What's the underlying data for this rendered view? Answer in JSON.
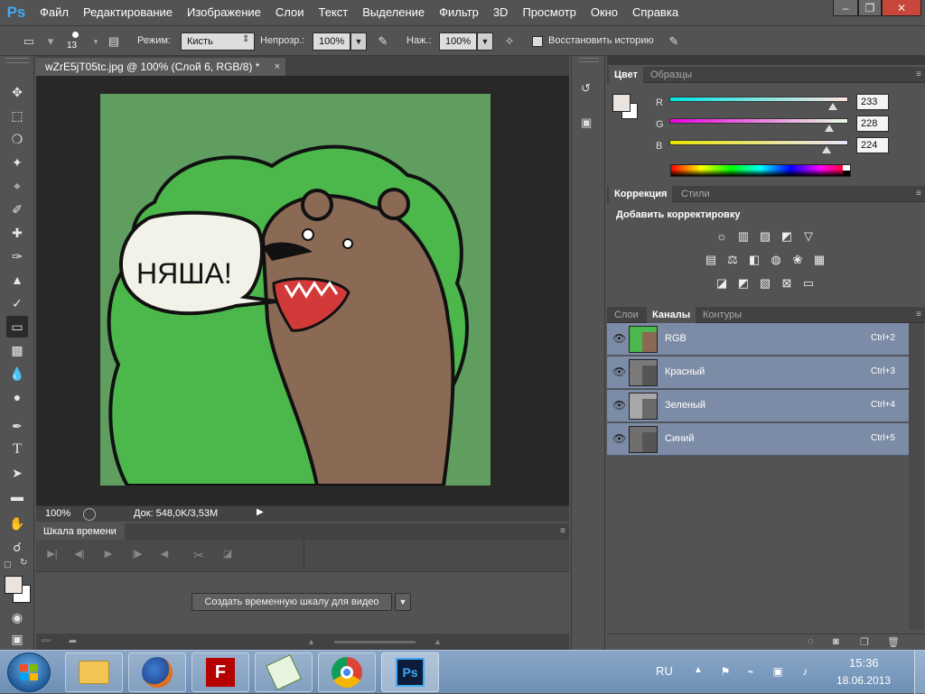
{
  "app": {
    "logo": "Ps",
    "menu": [
      "Файл",
      "Редактирование",
      "Изображение",
      "Слои",
      "Текст",
      "Выделение",
      "Фильтр",
      "3D",
      "Просмотр",
      "Окно",
      "Справка"
    ],
    "window_controls": {
      "minimize": "–",
      "restore": "❐",
      "close": "✕"
    }
  },
  "options_bar": {
    "brush_size": "13",
    "mode_label": "Режим:",
    "mode_value": "Кисть",
    "opacity_label": "Непрозр.:",
    "opacity_value": "100%",
    "flow_label": "Наж.:",
    "flow_value": "100%",
    "restore_history_label": "Восстановить историю"
  },
  "document": {
    "tab_title": "wZrE5jT05tc.jpg @ 100% (Слой 6, RGB/8) *",
    "close": "×",
    "zoom": "100%",
    "doc_size": "Док: 548,0K/3,53M",
    "speech_bubble_text": "НЯША!"
  },
  "timeline": {
    "tab": "Шкала времени",
    "create_button": "Создать временную шкалу для видео"
  },
  "color_panel": {
    "tabs": [
      "Цвет",
      "Образцы"
    ],
    "r_label": "R",
    "g_label": "G",
    "b_label": "B",
    "r": "233",
    "g": "228",
    "b": "224",
    "r_fraction": 0.914,
    "g_fraction": 0.894,
    "b_fraction": 0.878,
    "foreground_color": "#e9e4e0",
    "background_color": "#ffffff"
  },
  "adjustments_panel": {
    "tabs": [
      "Коррекция",
      "Стили"
    ],
    "heading": "Добавить корректировку"
  },
  "layers_panel": {
    "tabs": [
      "Слои",
      "Каналы",
      "Контуры"
    ],
    "channels": [
      {
        "name": "RGB",
        "shortcut": "Ctrl+2"
      },
      {
        "name": "Красный",
        "shortcut": "Ctrl+3"
      },
      {
        "name": "Зеленый",
        "shortcut": "Ctrl+4"
      },
      {
        "name": "Синий",
        "shortcut": "Ctrl+5"
      }
    ]
  },
  "taskbar": {
    "language": "RU",
    "time": "15:36",
    "date": "18.06.2013",
    "apps": [
      "explorer",
      "firefox",
      "filezilla",
      "notepad",
      "chrome",
      "photoshop"
    ]
  }
}
